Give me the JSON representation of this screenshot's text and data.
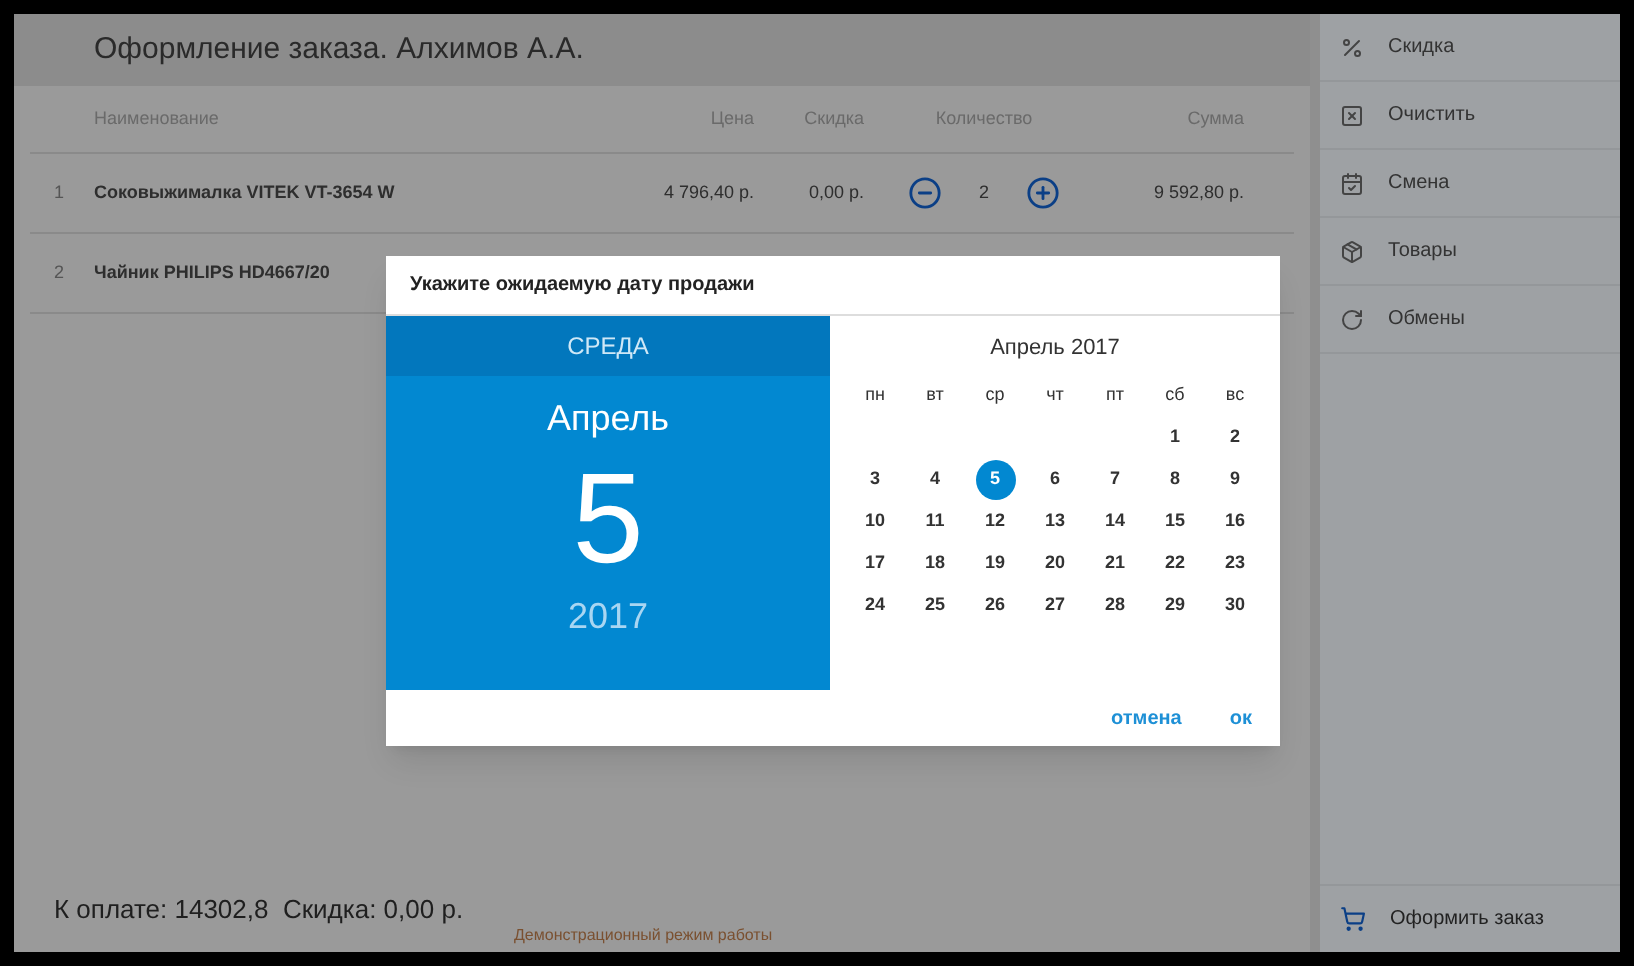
{
  "header": {
    "title": "Оформление заказа. Алхимов А.А."
  },
  "table": {
    "columns": [
      "Наименование",
      "Цена",
      "Скидка",
      "Количество",
      "Сумма"
    ],
    "rows": [
      {
        "index": "1",
        "name": "Соковыжималка VITEK VT-3654 W",
        "price": "4 796,40 р.",
        "discount": "0,00 р.",
        "quantity": "2",
        "sum": "9 592,80 р."
      },
      {
        "index": "2",
        "name": "Чайник PHILIPS HD4667/20"
      }
    ]
  },
  "footer": {
    "total": "К оплате: 14302,8  Скидка: 0,00 р.",
    "demo_note": "Демонстрационный режим работы"
  },
  "sidebar": {
    "items": [
      {
        "kind": "percent",
        "label": "Скидка"
      },
      {
        "kind": "clear",
        "label": "Очистить"
      },
      {
        "kind": "calendar",
        "label": "Смена"
      },
      {
        "kind": "goods",
        "label": "Товары"
      },
      {
        "kind": "refresh",
        "label": "Обмены"
      }
    ],
    "checkout": {
      "label": "Оформить заказ"
    }
  },
  "dialog": {
    "title": "Укажите ожидаемую дату продажи",
    "weekday": "СРЕДА",
    "month": "Апрель",
    "day": "5",
    "year": "2017",
    "calendar_title": "Апрель 2017",
    "weekdays": [
      "пн",
      "вт",
      "ср",
      "чт",
      "пт",
      "сб",
      "вс"
    ],
    "weeks": [
      [
        {
          "day": "1",
          "selected": false
        },
        {
          "day": "2",
          "selected": false
        }
      ],
      [
        {
          "day": "3",
          "selected": false
        },
        {
          "day": "4",
          "selected": false
        },
        {
          "day": "5",
          "selected": true
        },
        {
          "day": "6",
          "selected": false
        },
        {
          "day": "7",
          "selected": false
        },
        {
          "day": "8",
          "selected": false
        },
        {
          "day": "9",
          "selected": false
        }
      ],
      [
        {
          "day": "10",
          "selected": false
        },
        {
          "day": "11",
          "selected": false
        },
        {
          "day": "12",
          "selected": false
        },
        {
          "day": "13",
          "selected": false
        },
        {
          "day": "14",
          "selected": false
        },
        {
          "day": "15",
          "selected": false
        },
        {
          "day": "16",
          "selected": false
        }
      ],
      [
        {
          "day": "17",
          "selected": false
        },
        {
          "day": "18",
          "selected": false
        },
        {
          "day": "19",
          "selected": false
        },
        {
          "day": "20",
          "selected": false
        },
        {
          "day": "21",
          "selected": false
        },
        {
          "day": "22",
          "selected": false
        },
        {
          "day": "23",
          "selected": false
        }
      ],
      [
        {
          "day": "24",
          "selected": false
        },
        {
          "day": "25",
          "selected": false
        },
        {
          "day": "26",
          "selected": false
        },
        {
          "day": "27",
          "selected": false
        },
        {
          "day": "28",
          "selected": false
        },
        {
          "day": "29",
          "selected": false
        },
        {
          "day": "30",
          "selected": false
        }
      ]
    ],
    "buttons": [
      "отмена",
      "ок"
    ]
  }
}
